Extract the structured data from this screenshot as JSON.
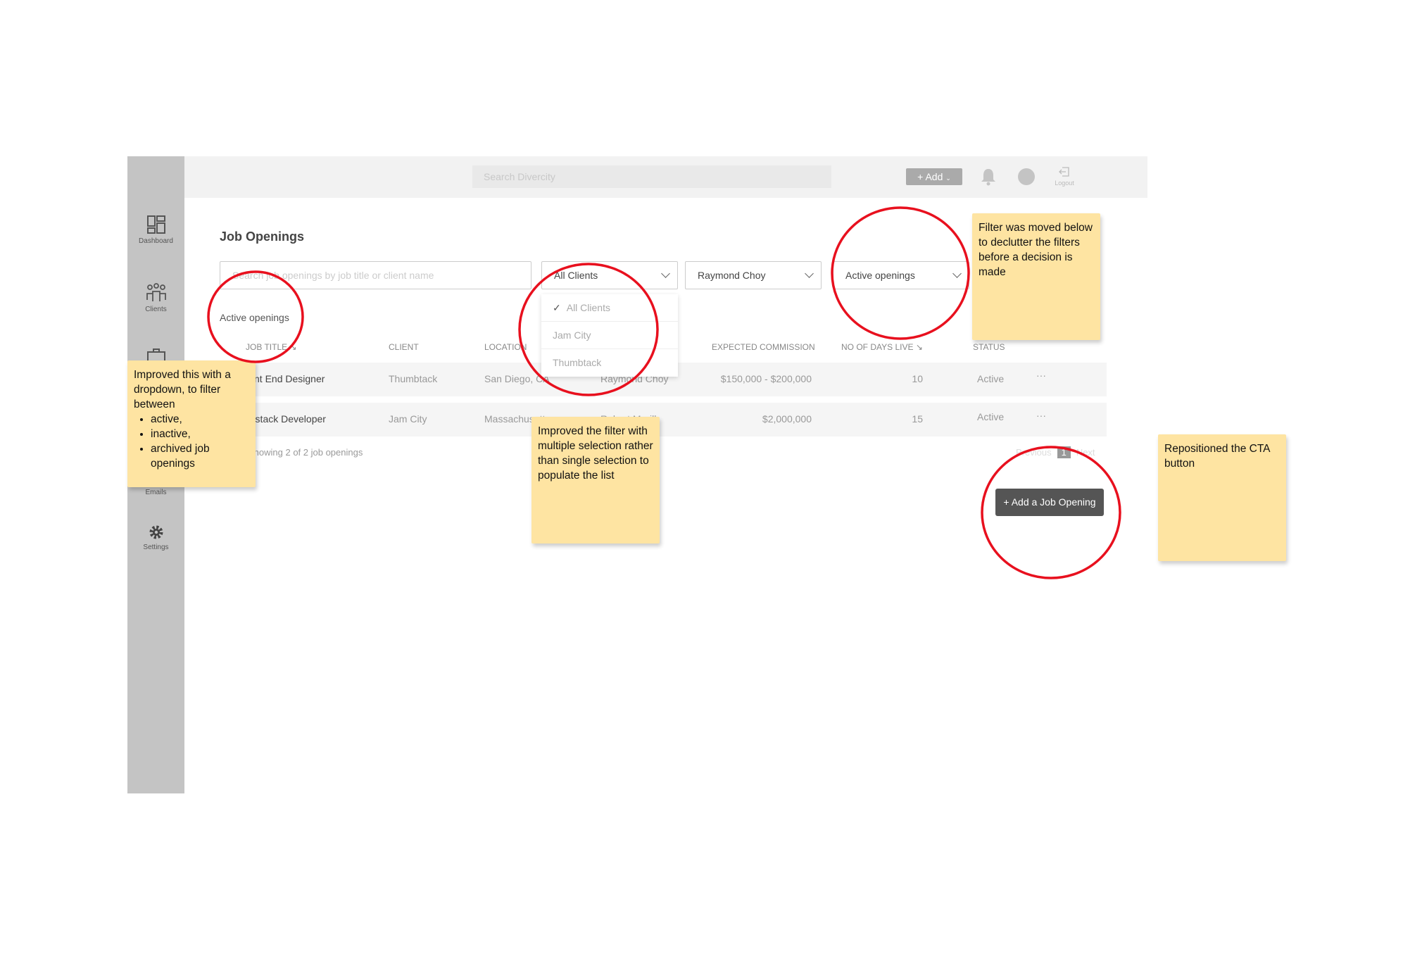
{
  "sidebar": {
    "items": [
      {
        "label": "Dashboard",
        "icon": "dashboard-icon"
      },
      {
        "label": "Clients",
        "icon": "clients-icon"
      },
      {
        "label": "",
        "icon": "briefcase-icon"
      },
      {
        "label": "Emails",
        "icon": "email-icon"
      },
      {
        "label": "Settings",
        "icon": "gear-icon"
      }
    ]
  },
  "topbar": {
    "search_placeholder": "Search Divercity",
    "add_label": "+ Add",
    "logout_label": "Logout"
  },
  "page": {
    "title": "Job Openings"
  },
  "filters": {
    "search_placeholder": "Search job openings by job title or client name",
    "client": "All Clients",
    "owner": "Raymond Choy",
    "status": "Active openings"
  },
  "client_menu": {
    "items": [
      "All Clients",
      "Jam City",
      "Thumbtack"
    ],
    "selected": "All Clients"
  },
  "status_label": "Active openings",
  "table": {
    "headers": [
      "JOB TITLE",
      "CLIENT",
      "LOCATION",
      "EXPECTED COMMISSION",
      "NO OF DAYS LIVE",
      "STATUS"
    ],
    "rows": [
      {
        "title": "Front End Designer",
        "client": "Thumbtack",
        "location": "San Diego, CA",
        "owner": "Raymond Choy",
        "commission": "$150,000 - $200,000",
        "days": "10",
        "status": "Active"
      },
      {
        "title": "Fullstack Developer",
        "client": "Jam City",
        "location": "Massachusetts",
        "owner": "Robert Merill",
        "commission": "$2,000,000",
        "days": "15",
        "status": "Active"
      }
    ]
  },
  "footer": {
    "showing": "Showing 2 of 2 job openings",
    "previous": "Previous",
    "page": "1",
    "next": "Next"
  },
  "cta": {
    "label": "+ Add a Job Opening"
  },
  "notes": {
    "filter_moved": "Filter was moved below to declutter the filters before a decision is made",
    "dropdown_intro": "Improved this with a dropdown, to filter between",
    "dropdown_items": [
      "active,",
      "inactive,",
      "archived job openings"
    ],
    "multi_select": "Improved the filter with multiple selection rather than single selection to populate the list",
    "cta": "Repositioned the CTA button"
  },
  "colors": {
    "annotation_circle": "#e8101e",
    "sticky_note": "#fee4a2",
    "cta": "#555555"
  }
}
